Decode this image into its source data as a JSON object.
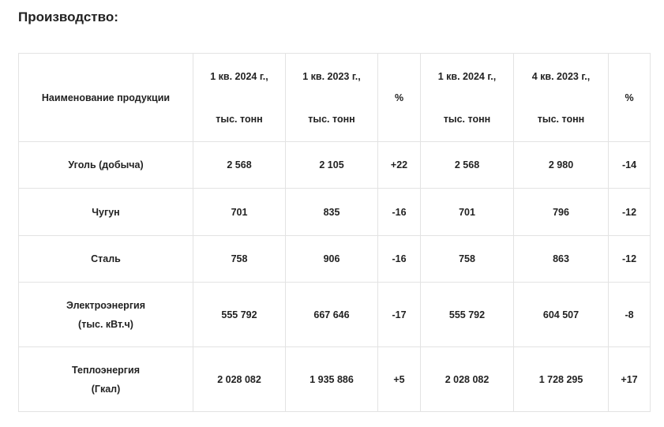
{
  "heading": "Производство:",
  "table": {
    "header": {
      "name": "Наименование продукции",
      "col1": {
        "line1": "1 кв. 2024 г.,",
        "line2": "тыс. тонн"
      },
      "col2": {
        "line1": "1 кв. 2023 г.,",
        "line2": "тыс. тонн"
      },
      "col3": "%",
      "col4": {
        "line1": "1 кв. 2024 г.,",
        "line2": "тыс. тонн"
      },
      "col5": {
        "line1": "4 кв. 2023 г.,",
        "line2": "тыс. тонн"
      },
      "col6": "%"
    },
    "rows": [
      {
        "name": "Уголь (добыча)",
        "v1": "2 568",
        "v2": "2 105",
        "p1": "+22",
        "v3": "2 568",
        "v4": "2 980",
        "p2": "-14"
      },
      {
        "name": "Чугун",
        "v1": "701",
        "v2": "835",
        "p1": "-16",
        "v3": "701",
        "v4": "796",
        "p2": "-12"
      },
      {
        "name": "Сталь",
        "v1": "758",
        "v2": "906",
        "p1": "-16",
        "v3": "758",
        "v4": "863",
        "p2": "-12"
      },
      {
        "name_line1": "Электроэнергия",
        "name_line2": "(тыс. кВт.ч)",
        "v1": "555 792",
        "v2": "667 646",
        "p1": "-17",
        "v3": "555 792",
        "v4": "604 507",
        "p2": "-8"
      },
      {
        "name_line1": "Теплоэнергия",
        "name_line2": "(Гкал)",
        "v1": "2 028 082",
        "v2": "1 935 886",
        "p1": "+5",
        "v3": "2 028 082",
        "v4": "1 728 295",
        "p2": "+17"
      }
    ]
  }
}
